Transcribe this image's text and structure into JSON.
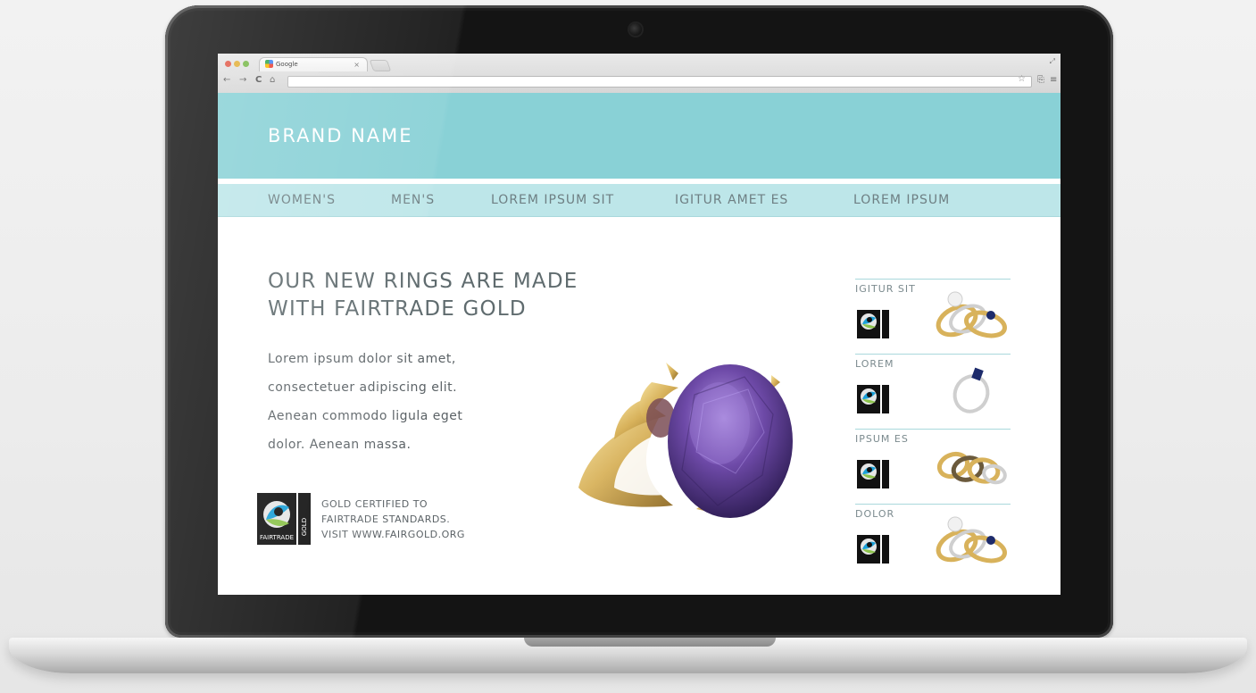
{
  "browser": {
    "tab_title": "Google",
    "tab_close": "×",
    "resize": "⤢",
    "nav": {
      "back": "←",
      "forward": "→",
      "reload": "C",
      "home": "⌂"
    },
    "url_value": "",
    "star": "☆",
    "right_icons": [
      "⎘",
      "≡"
    ]
  },
  "site": {
    "brand_name": "BRAND NAME",
    "nav_items": [
      "WOMEN'S",
      "MEN'S",
      "LOREM IPSUM SIT",
      "IGITUR AMET ES",
      "LOREM IPSUM"
    ],
    "hero": {
      "title_lines": [
        "OUR NEW RINGS ARE MADE",
        "WITH FAIRTRADE GOLD"
      ],
      "body_lines": [
        "Lorem ipsum dolor sit amet,",
        "consectetuer adipiscing elit.",
        "Aenean commodo ligula eget",
        "dolor. Aenean massa."
      ]
    },
    "certification": {
      "logo_text": "FAIRTRADE",
      "badge_text": "GOLD",
      "lines": [
        "GOLD CERTIFIED TO",
        "FAIRTRADE STANDARDS.",
        "VISIT WWW.FAIRGOLD.ORG"
      ]
    },
    "side_items": [
      {
        "label": "IGITUR SIT"
      },
      {
        "label": "LOREM"
      },
      {
        "label": "IPSUM ES"
      },
      {
        "label": "DOLOR"
      }
    ]
  },
  "colors": {
    "header": "#89d1d6",
    "nav": "#bde6e9",
    "text": "#5f6b6e",
    "gem": "#6e4aa8",
    "gold": "#d8b25b"
  }
}
